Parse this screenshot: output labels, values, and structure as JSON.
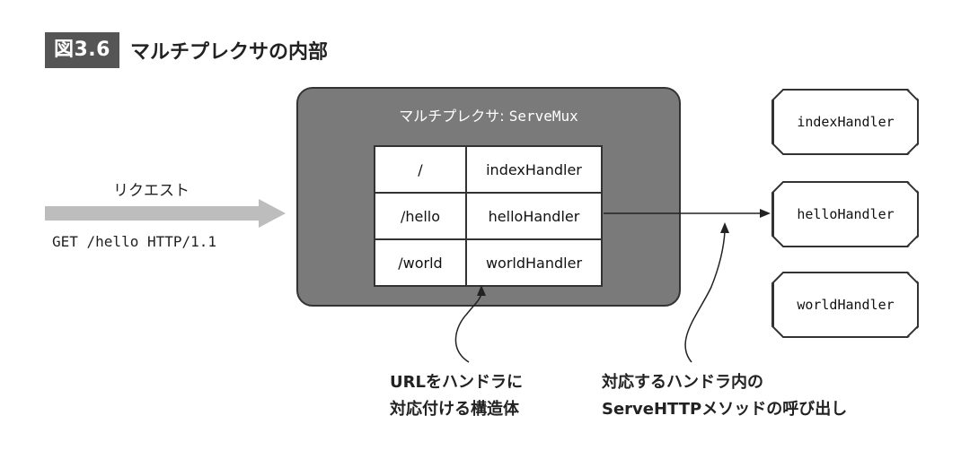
{
  "figure": {
    "number": "図3.6",
    "title": "マルチプレクサの内部"
  },
  "request": {
    "label": "リクエスト",
    "line": "GET /hello HTTP/1.1"
  },
  "mux": {
    "label": "マルチプレクサ:",
    "type": "ServeMux",
    "routes": [
      {
        "path": "/",
        "handler": "indexHandler"
      },
      {
        "path": "/hello",
        "handler": "helloHandler"
      },
      {
        "path": "/world",
        "handler": "worldHandler"
      }
    ]
  },
  "handlers": [
    "indexHandler",
    "helloHandler",
    "worldHandler"
  ],
  "notes": {
    "mapping": [
      "URLをハンドラに",
      "対応付ける構造体"
    ],
    "call": [
      "対応するハンドラ内の",
      "ServeHTTPメソッドの呼び出し"
    ]
  },
  "colors": {
    "badge": "#555555",
    "mux_fill": "#7a7a7a",
    "arrow_gray": "#bdbdbd"
  }
}
